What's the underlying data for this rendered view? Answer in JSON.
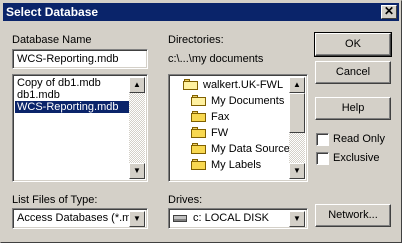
{
  "window": {
    "title": "Select Database",
    "close_glyph": "✕"
  },
  "database_name": {
    "label": "Database Name",
    "value": "WCS-Reporting.mdb",
    "files": [
      {
        "name": "Copy of db1.mdb",
        "selected": false
      },
      {
        "name": "db1.mdb",
        "selected": false
      },
      {
        "name": "WCS-Reporting.mdb",
        "selected": true
      }
    ]
  },
  "directories": {
    "label": "Directories:",
    "current_path": "c:\\...\\my documents",
    "items": [
      {
        "name": "walkert.UK-FWL",
        "icon": "open-folder-icon"
      },
      {
        "name": "My Documents",
        "icon": "open-folder-icon"
      },
      {
        "name": "Fax",
        "icon": "folder-icon"
      },
      {
        "name": "FW",
        "icon": "folder-icon"
      },
      {
        "name": "My Data Source",
        "icon": "folder-icon"
      },
      {
        "name": "My Labels",
        "icon": "folder-icon"
      }
    ]
  },
  "file_type": {
    "label": "List Files of Type:",
    "value": "Access Databases (*.m"
  },
  "drives": {
    "label": "Drives:",
    "value": "c: LOCAL DISK"
  },
  "buttons": {
    "ok": "OK",
    "cancel": "Cancel",
    "help": "Help",
    "network": "Network..."
  },
  "options": {
    "read_only": {
      "label": "Read Only",
      "checked": false
    },
    "exclusive": {
      "label": "Exclusive",
      "checked": false
    }
  },
  "icons": {
    "scroll_up": "▲",
    "scroll_down": "▼",
    "dropdown": "▼"
  }
}
